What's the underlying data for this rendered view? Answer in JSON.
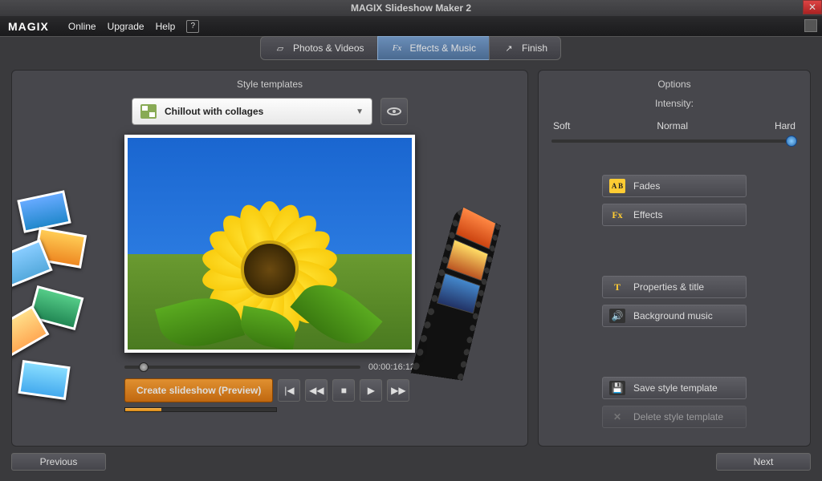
{
  "window": {
    "title": "MAGIX Slideshow Maker 2"
  },
  "brand": "MAGIX",
  "menu": {
    "online": "Online",
    "upgrade": "Upgrade",
    "help": "Help"
  },
  "tabs": {
    "photos": "Photos & Videos",
    "effects": "Effects & Music",
    "finish": "Finish"
  },
  "left": {
    "title": "Style templates",
    "dropdown": "Chillout with collages",
    "timecode": "00:00:16:12",
    "create": "Create slideshow (Preview)"
  },
  "right": {
    "title": "Options",
    "intensity_label": "Intensity:",
    "soft": "Soft",
    "normal": "Normal",
    "hard": "Hard",
    "fades": "Fades",
    "effects": "Effects",
    "props": "Properties & title",
    "music": "Background music",
    "save": "Save style template",
    "delete": "Delete style template"
  },
  "nav": {
    "prev": "Previous",
    "next": "Next"
  }
}
